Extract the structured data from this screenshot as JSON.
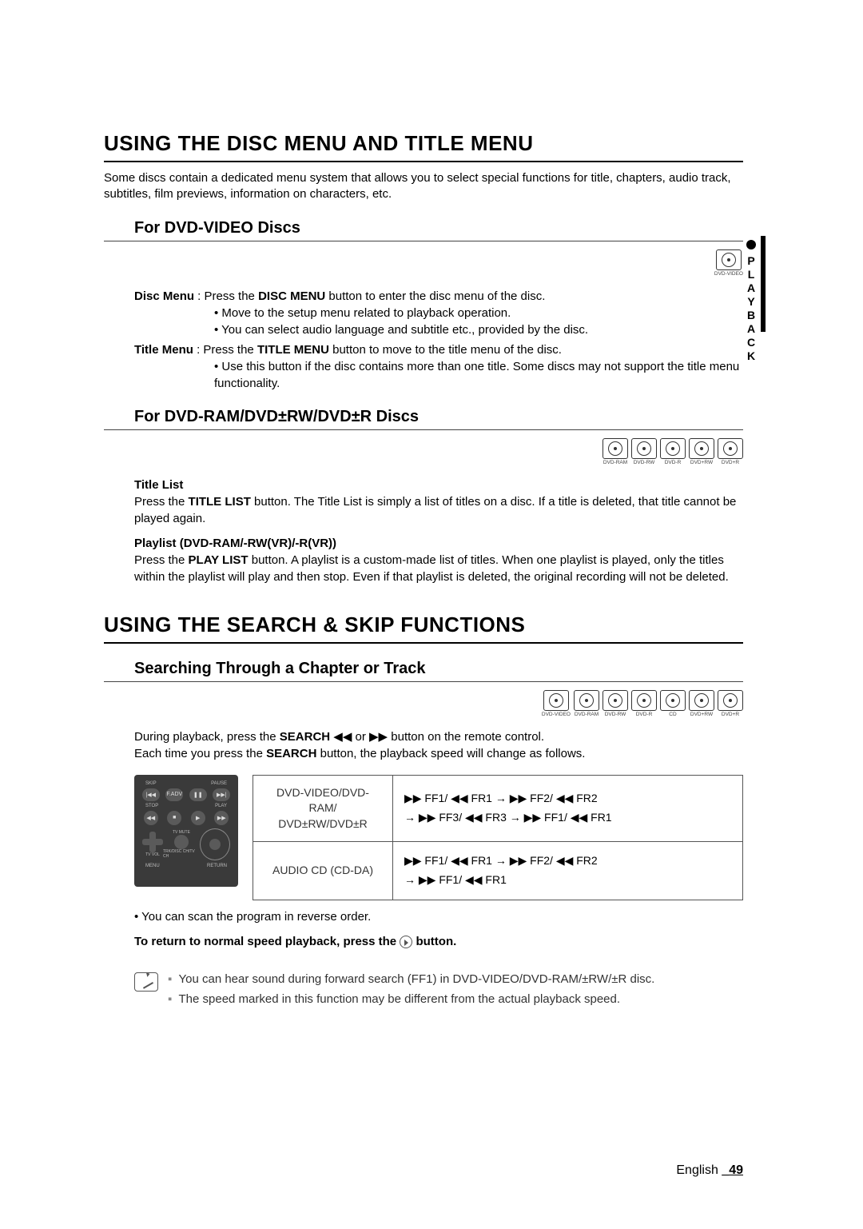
{
  "sideTab": "PLAYBACK",
  "h1a": "USING THE DISC MENU AND TITLE MENU",
  "intro": "Some discs contain a dedicated menu system that allows you to select special functions for title, chapters, audio track, subtitles, film previews, information on characters, etc.",
  "h2a": "For DVD-VIDEO Discs",
  "discIcons_video": [
    "DVD-VIDEO"
  ],
  "dvdvideo": {
    "discMenuLabel": "Disc Menu",
    "discMenuText": " : Press the ",
    "discMenuBtn": "DISC MENU",
    "discMenuTail": " button to enter the disc menu of the disc.",
    "dm_b1": "Move to the setup menu related to playback operation.",
    "dm_b2": "You can select audio language and subtitle etc., provided by the disc.",
    "titleMenuLabel": "Title Menu",
    "titleMenuText": " : Press the ",
    "titleMenuBtn": "TITLE MENU",
    "titleMenuTail": " button to move to the title menu of the disc.",
    "tm_b1": "Use this button if the disc contains more than one title. Some discs may not support the title menu functionality."
  },
  "h2b": "For DVD-RAM/DVD±RW/DVD±R Discs",
  "discIcons_ram": [
    "DVD-RAM",
    "DVD-RW",
    "DVD-R",
    "DVD+RW",
    "DVD+R"
  ],
  "ram": {
    "tlHead": "Title List",
    "tlBody1": "Press the ",
    "tlBtn": "TITLE LIST",
    "tlBody2": " button. The Title List is simply a list of titles on a disc. If a title is deleted, that title cannot be played again.",
    "plHead": "Playlist (DVD-RAM/-RW(VR)/-R(VR))",
    "plBody1": "Press the ",
    "plBtn": "PLAY LIST",
    "plBody2": " button. A playlist is a custom-made list of titles. When one playlist is played, only the titles within the playlist will play and then stop. Even if that playlist is deleted, the original recording will not be deleted."
  },
  "h1b": "USING THE SEARCH & SKIP FUNCTIONS",
  "h2c": "Searching Through a Chapter or Track",
  "discIcons_search": [
    "DVD-VIDEO",
    "DVD-RAM",
    "DVD-RW",
    "DVD-R",
    "CD",
    "DVD+RW",
    "DVD+R"
  ],
  "search": {
    "p1a": "During playback, press the ",
    "p1btn": "SEARCH",
    "p1b": " ◀◀ or ▶▶ button on the remote control.",
    "p2a": "Each time you press the ",
    "p2btn": "SEARCH",
    "p2b": " button, the playback speed will change as follows."
  },
  "remote": {
    "row1": [
      "SKIP",
      "PAUSE"
    ],
    "row1btns": [
      "|◀◀",
      "F.ADV",
      "❚❚",
      "▶▶|"
    ],
    "row2": [
      "STOP",
      "PLAY"
    ],
    "row2btns": [
      "◀◀",
      "■",
      "▶",
      "▶▶"
    ],
    "midLeft": "TV MUTE",
    "midTiny": "TV VOL",
    "midRight": "TRK/DISC CH/TV CH",
    "foot": [
      "MENU",
      "RETURN"
    ]
  },
  "table": {
    "r1a": "DVD-VIDEO/DVD-RAM/",
    "r1b": "DVD±RW/DVD±R",
    "r1seq1": "▶▶ FF1/ ◀◀ FR1 → ▶▶ FF2/ ◀◀ FR2",
    "r1seq2": "→ ▶▶ FF3/ ◀◀ FR3 → ▶▶ FF1/ ◀◀ FR1",
    "r2a": "AUDIO CD (CD-DA)",
    "r2seq1": "▶▶ FF1/ ◀◀ FR1 → ▶▶ FF2/ ◀◀ FR2",
    "r2seq2": "→ ▶▶ FF1/ ◀◀ FR1"
  },
  "reverse": "You can scan the program in reverse order.",
  "normalNote_a": "To return to normal speed playback, press the ",
  "normalNote_b": " button.",
  "notes": {
    "n1": "You can hear sound during forward search (FF1) in DVD-VIDEO/DVD-RAM/±RW/±R disc.",
    "n2": "The speed marked in this function may be different from the actual playback speed."
  },
  "footer": {
    "lang": "English ",
    "page": "_49"
  }
}
